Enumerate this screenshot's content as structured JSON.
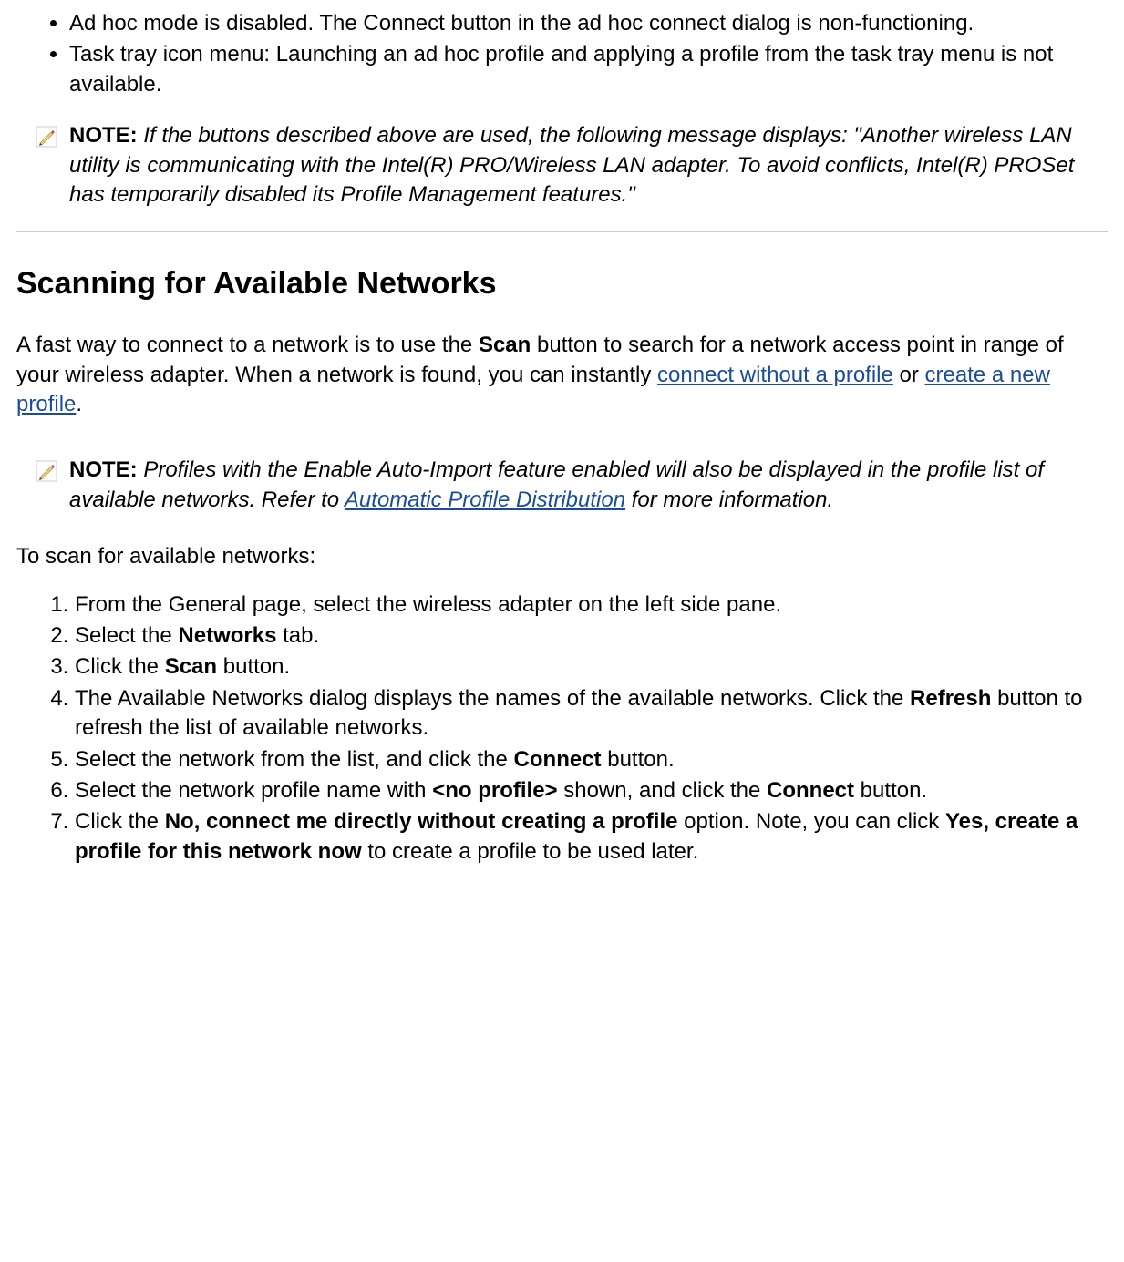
{
  "bullets": {
    "item1": "Ad hoc mode is disabled. The Connect button in the ad hoc connect dialog is non-functioning.",
    "item2": "Task tray icon menu: Launching an ad hoc profile and applying a profile from the task tray menu is not available."
  },
  "note1": {
    "label": "NOTE:",
    "text": "If the buttons described above are used, the following message displays: \"Another wireless LAN utility is communicating with the Intel(R) PRO/Wireless LAN adapter. To avoid conflicts, Intel(R) PROSet has temporarily disabled its Profile Management features.\""
  },
  "heading": "Scanning for Available Networks",
  "intro": {
    "pre": "A fast way to connect to a network is to use the ",
    "scan_bold": "Scan",
    "mid1": " button to search for a network access point in range of your wireless adapter. When a network is found, you can instantly ",
    "link1": "connect without a profile",
    "mid2": " or ",
    "link2": "create a new profile",
    "post": "."
  },
  "note2": {
    "label": "NOTE:",
    "pre": "Profiles with the Enable Auto-Import feature enabled will also be displayed in the profile list of available networks. Refer to ",
    "link": "Automatic Profile Distribution",
    "post": " for more information."
  },
  "scan_lead": "To scan for available networks:",
  "steps": {
    "s1": "From the General page, select the wireless adapter on the left side pane.",
    "s2_pre": "Select the ",
    "s2_bold": "Networks",
    "s2_post": " tab.",
    "s3_pre": "Click the ",
    "s3_bold": "Scan",
    "s3_post": " button.",
    "s4_pre": "The Available Networks dialog displays the names of the available networks. Click the ",
    "s4_bold": "Refresh",
    "s4_post": " button to refresh the list of available networks.",
    "s5_pre": "Select the network from the list, and click the ",
    "s5_bold": "Connect",
    "s5_post": " button.",
    "s6_pre": "Select the network profile name with ",
    "s6_bold1": "<no profile>",
    "s6_mid": " shown, and click the ",
    "s6_bold2": "Connect",
    "s6_post": " button.",
    "s7_pre": "Click the ",
    "s7_bold1": "No, connect me directly without creating a profile",
    "s7_mid": " option. Note, you can click ",
    "s7_bold2": "Yes, create a profile for this network now",
    "s7_post": " to create a profile to be used later."
  }
}
